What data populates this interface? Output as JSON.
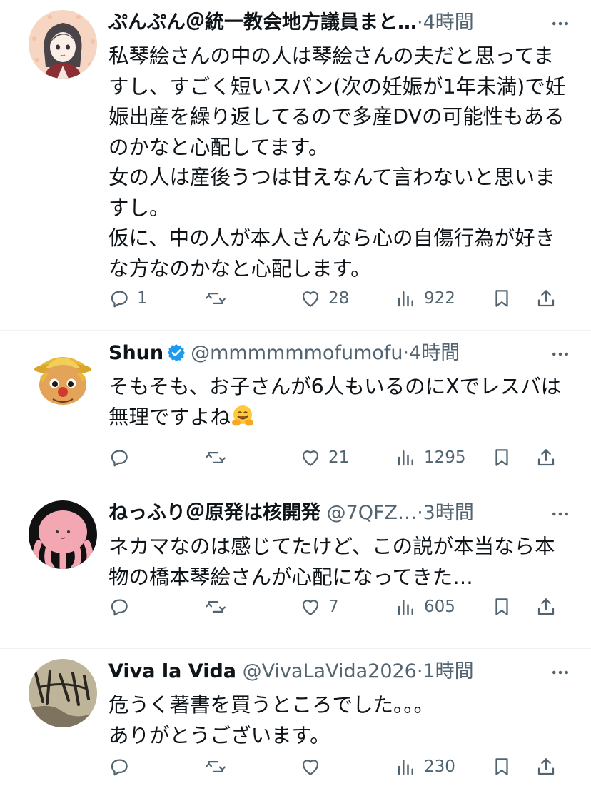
{
  "tweets": [
    {
      "name": "ぷんぷん＠統一教会地方議員まと…",
      "handle": "",
      "dot": "·",
      "time": "4時間",
      "text": "私琴絵さんの中の人は琴絵さんの夫だと思ってますし、すごく短いスパン(次の妊娠が1年未満)で妊娠出産を繰り返してるので多産DVの可能性もあるのかなと心配してます。\n女の人は産後うつは甘えなんて言わないと思いますし。\n仮に、中の人が本人さんなら心の自傷行為が好きな方なのかなと心配します。",
      "replies": "1",
      "retweets": "",
      "likes": "28",
      "views": "922"
    },
    {
      "name": "Shun",
      "handle": "@mmmmmmofumofu",
      "dot": "·",
      "time": "4時間",
      "text": "そもそも、お子さんが6人もいるのにXでレスバは無理ですよね",
      "replies": "",
      "retweets": "",
      "likes": "21",
      "views": "1295"
    },
    {
      "name": "ねっふり＠原発は核開発",
      "handle": "@7QFZ…",
      "dot": "·",
      "time": "3時間",
      "text": "ネカマなのは感じてたけど、この説が本当なら本物の橋本琴絵さんが心配になってきた…",
      "replies": "",
      "retweets": "",
      "likes": "7",
      "views": "605"
    },
    {
      "name": "Viva la Vida",
      "handle": "@VivaLaVida2026",
      "dot": "·",
      "time": "1時間",
      "text": "危うく著書を買うところでした。。。\nありがとうございます。",
      "replies": "",
      "retweets": "",
      "likes": "",
      "views": "230"
    }
  ],
  "icons": {
    "more": "more-horizontal-icon",
    "reply": "reply-bubble-icon",
    "retweet": "retweet-icon",
    "like": "heart-icon",
    "views": "views-bar-chart-icon",
    "bookmark": "bookmark-icon",
    "share": "share-upload-icon",
    "verified": "verified-badge-icon"
  },
  "colors": {
    "text": "#0f1419",
    "secondary": "#536471",
    "verified": "#1d9bf0",
    "divider": "#eff3f4"
  }
}
